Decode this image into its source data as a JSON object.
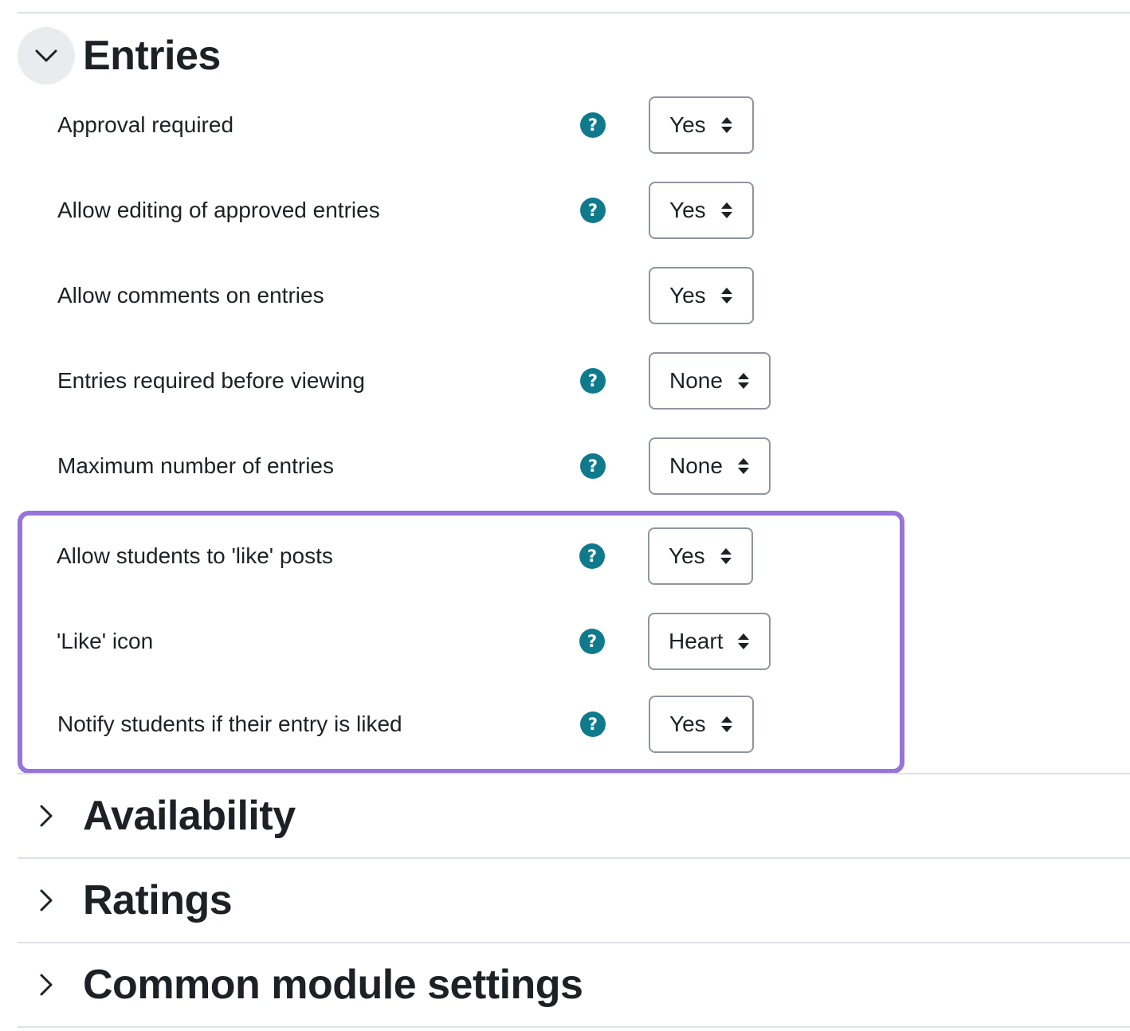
{
  "sections": {
    "entries": {
      "title": "Entries",
      "expanded": true
    },
    "availability": {
      "title": "Availability",
      "expanded": false
    },
    "ratings": {
      "title": "Ratings",
      "expanded": false
    },
    "common": {
      "title": "Common module settings",
      "expanded": false
    }
  },
  "fields": [
    {
      "label": "Approval required",
      "value": "Yes",
      "has_help": true
    },
    {
      "label": "Allow editing of approved entries",
      "value": "Yes",
      "has_help": true
    },
    {
      "label": "Allow comments on entries",
      "value": "Yes",
      "has_help": false
    },
    {
      "label": "Entries required before viewing",
      "value": "None",
      "has_help": true
    },
    {
      "label": "Maximum number of entries",
      "value": "None",
      "has_help": true
    },
    {
      "label": "Allow students to 'like' posts",
      "value": "Yes",
      "has_help": true
    },
    {
      "label": "'Like' icon",
      "value": "Heart",
      "has_help": true
    },
    {
      "label": "Notify students if their entry is liked",
      "value": "Yes",
      "has_help": true
    }
  ],
  "help_icon_glyph": "?",
  "colors": {
    "help_icon": "#0f7a8c",
    "highlight": "#9773da",
    "select_border": "#8f959e",
    "toggle_bg": "#e9ecef",
    "divider": "#dee2e6"
  }
}
